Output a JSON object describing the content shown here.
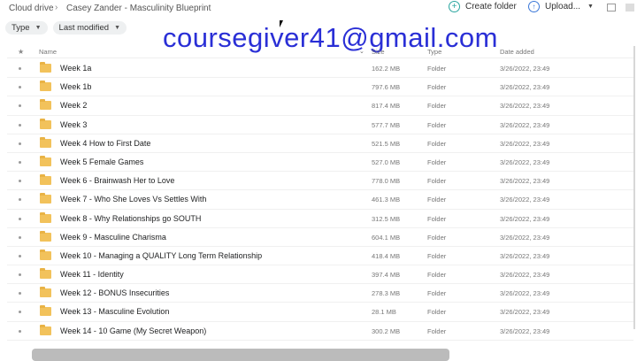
{
  "breadcrumb": {
    "root": "Cloud drive",
    "separator": "›",
    "current": "Casey Zander - Masculinity Blueprint"
  },
  "actions": {
    "create_folder": "Create folder",
    "upload": "Upload..."
  },
  "filters": {
    "type": "Type",
    "last_modified": "Last modified"
  },
  "watermark": "coursegiver41@gmail.com",
  "table": {
    "headers": {
      "name": "Name",
      "size": "Size",
      "type": "Type",
      "date": "Date added"
    },
    "rows": [
      {
        "name": "Week 1a",
        "size": "162.2 MB",
        "type": "Folder",
        "date": "3/26/2022, 23:49"
      },
      {
        "name": "Week 1b",
        "size": "797.6 MB",
        "type": "Folder",
        "date": "3/26/2022, 23:49"
      },
      {
        "name": "Week 2",
        "size": "817.4 MB",
        "type": "Folder",
        "date": "3/26/2022, 23:49"
      },
      {
        "name": "Week 3",
        "size": "577.7 MB",
        "type": "Folder",
        "date": "3/26/2022, 23:49"
      },
      {
        "name": "Week 4 How to First Date",
        "size": "521.5 MB",
        "type": "Folder",
        "date": "3/26/2022, 23:49"
      },
      {
        "name": "Week 5 Female Games",
        "size": "527.0 MB",
        "type": "Folder",
        "date": "3/26/2022, 23:49"
      },
      {
        "name": "Week 6 - Brainwash Her to Love",
        "size": "778.0 MB",
        "type": "Folder",
        "date": "3/26/2022, 23:49"
      },
      {
        "name": "Week 7 - Who She Loves Vs Settles With",
        "size": "461.3 MB",
        "type": "Folder",
        "date": "3/26/2022, 23:49"
      },
      {
        "name": "Week 8 - Why Relationships go SOUTH",
        "size": "312.5 MB",
        "type": "Folder",
        "date": "3/26/2022, 23:49"
      },
      {
        "name": "Week 9 - Masculine Charisma",
        "size": "604.1 MB",
        "type": "Folder",
        "date": "3/26/2022, 23:49"
      },
      {
        "name": "Week 10 - Managing a QUALITY Long Term Relationship",
        "size": "418.4 MB",
        "type": "Folder",
        "date": "3/26/2022, 23:49"
      },
      {
        "name": "Week 11 - Identity",
        "size": "397.4 MB",
        "type": "Folder",
        "date": "3/26/2022, 23:49"
      },
      {
        "name": "Week 12 - BONUS Insecurities",
        "size": "278.3 MB",
        "type": "Folder",
        "date": "3/26/2022, 23:49"
      },
      {
        "name": "Week 13 - Masculine Evolution",
        "size": "28.1 MB",
        "type": "Folder",
        "date": "3/26/2022, 23:49"
      },
      {
        "name": "Week 14 - 10 Game (My Secret Weapon)",
        "size": "300.2 MB",
        "type": "Folder",
        "date": "3/26/2022, 23:49"
      }
    ]
  },
  "icons": {
    "row_icon": "folder-icon",
    "create": "plus-circle-icon",
    "upload": "upload-arrow-icon"
  }
}
